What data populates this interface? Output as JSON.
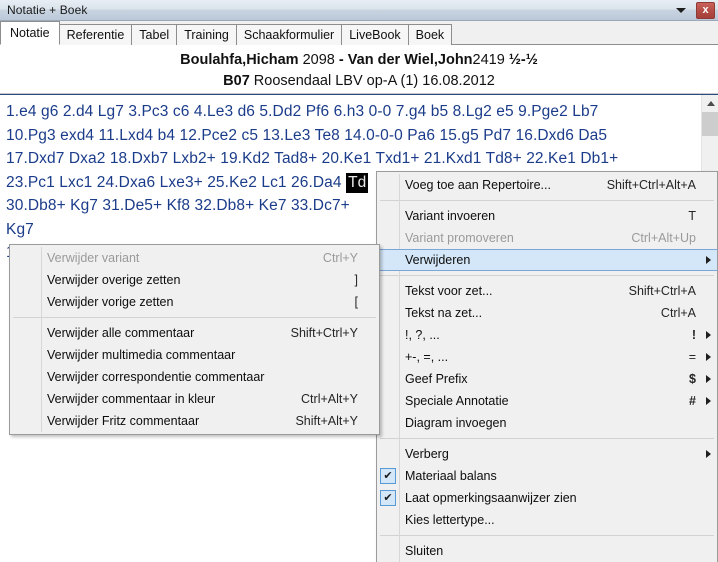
{
  "window": {
    "title": "Notatie + Boek",
    "caret_icon": "chevron-down-icon",
    "close_label": "x"
  },
  "tabs": [
    {
      "label": "Notatie",
      "active": true
    },
    {
      "label": "Referentie",
      "active": false
    },
    {
      "label": "Tabel",
      "active": false
    },
    {
      "label": "Training",
      "active": false
    },
    {
      "label": "Schaakformulier",
      "active": false
    },
    {
      "label": "LiveBook",
      "active": false
    },
    {
      "label": "Boek",
      "active": false
    }
  ],
  "game_header": {
    "white_name": "Boulahfa,Hicham",
    "white_elo": "2098",
    "dash": "-",
    "black_name": "Van der Wiel,John",
    "black_elo": "2419",
    "result": "½-½",
    "eco": "B07",
    "event": "Roosendaal LBV op-A (1) 16.08.2012"
  },
  "notation": {
    "lines": [
      "1.e4 g6 2.d4 Lg7 3.Pc3 c6 4.Le3 d6 5.Dd2 Pf6 6.h3 0-0 7.g4 b5 8.Lg2 e5 9.Pge2 Lb7",
      "10.Pg3 exd4 11.Lxd4 b4 12.Pce2 c5 13.Le3 Te8 14.0-0-0 Pa6 15.g5 Pd7 16.Dxd6 Da5",
      "17.Dxd7 Dxa2 18.Dxb7 Lxb2+ 19.Kd2 Tad8+ 20.Ke1 Txd1+ 21.Kxd1 Td8+ 22.Ke1 Db1+"
    ],
    "line4_pre": "23.Pc1 Lxc1 24.Dxa6 Lxe3+ 25.Ke2 Lc1 26.Da4",
    "selected_move": "Td",
    "line5": "30.Db8+ Kg7 31.De5+ Kf8 32.Db8+ Ke7 33.Dc7+",
    "line6": "Kg7",
    "line7_partial": "1"
  },
  "scrollbar": {
    "up_icon": "chevron-up-icon"
  },
  "main_menu": {
    "items": [
      {
        "label": "Voeg toe aan Repertoire...",
        "accel": "Shift+Ctrl+Alt+A",
        "arrow": false,
        "disabled": false,
        "checked": null,
        "highlighted": false
      },
      {
        "separator": true
      },
      {
        "label": "Variant invoeren",
        "accel": "T",
        "arrow": false,
        "disabled": false,
        "checked": null,
        "highlighted": false
      },
      {
        "label": "Variant promoveren",
        "accel": "Ctrl+Alt+Up",
        "arrow": false,
        "disabled": true,
        "checked": null,
        "highlighted": false
      },
      {
        "label": "Verwijderen",
        "accel": "",
        "arrow": true,
        "disabled": false,
        "checked": null,
        "highlighted": true
      },
      {
        "separator": true
      },
      {
        "label": "Tekst voor zet...",
        "accel": "Shift+Ctrl+A",
        "arrow": false,
        "disabled": false,
        "checked": null,
        "highlighted": false
      },
      {
        "label": "Tekst na zet...",
        "accel": "Ctrl+A",
        "arrow": false,
        "disabled": false,
        "checked": null,
        "highlighted": false
      },
      {
        "label": "!, ?, ...",
        "accel": "!",
        "accel_style": "red",
        "arrow": true,
        "disabled": false,
        "checked": null,
        "highlighted": false
      },
      {
        "label": "+-, =, ...",
        "accel": "=",
        "arrow": true,
        "disabled": false,
        "checked": null,
        "highlighted": false
      },
      {
        "label": "Geef Prefix",
        "accel": "$",
        "accel_style": "dollar",
        "arrow": true,
        "disabled": false,
        "checked": null,
        "highlighted": false
      },
      {
        "label": "Speciale Annotatie",
        "accel": "#",
        "accel_style": "hash",
        "arrow": true,
        "disabled": false,
        "checked": null,
        "highlighted": false
      },
      {
        "label": "Diagram invoegen",
        "accel": "",
        "arrow": false,
        "disabled": false,
        "checked": null,
        "highlighted": false
      },
      {
        "separator": true
      },
      {
        "label": "Verberg",
        "accel": "",
        "arrow": true,
        "disabled": false,
        "checked": null,
        "highlighted": false
      },
      {
        "label": "Materiaal balans",
        "accel": "",
        "arrow": false,
        "disabled": false,
        "checked": true,
        "highlighted": false
      },
      {
        "label": "Laat opmerkingsaanwijzer zien",
        "accel": "",
        "arrow": false,
        "disabled": false,
        "checked": true,
        "highlighted": false
      },
      {
        "label": "Kies lettertype...",
        "accel": "",
        "arrow": false,
        "disabled": false,
        "checked": null,
        "highlighted": false
      },
      {
        "separator": true
      },
      {
        "label": "Sluiten",
        "accel": "",
        "arrow": false,
        "disabled": false,
        "checked": null,
        "highlighted": false
      }
    ]
  },
  "sub_menu": {
    "items": [
      {
        "label": "Verwijder variant",
        "accel": "Ctrl+Y",
        "disabled": true
      },
      {
        "label": "Verwijder overige zetten",
        "accel": "]",
        "disabled": false
      },
      {
        "label": "Verwijder vorige zetten",
        "accel": "[",
        "disabled": false
      },
      {
        "separator": true
      },
      {
        "label": "Verwijder alle commentaar",
        "accel": "Shift+Ctrl+Y",
        "disabled": false
      },
      {
        "label": "Verwijder multimedia commentaar",
        "accel": "",
        "disabled": false
      },
      {
        "label": "Verwijder correspondentie commentaar",
        "accel": "",
        "disabled": false
      },
      {
        "label": "Verwijder commentaar in kleur",
        "accel": "Ctrl+Alt+Y",
        "disabled": false
      },
      {
        "label": "Verwijder Fritz commentaar",
        "accel": "Shift+Alt+Y",
        "disabled": false
      }
    ]
  },
  "colors": {
    "notation_text": "#1b3c8a",
    "highlight_bg": "#d4e7f8",
    "highlight_border": "#7ba7d7",
    "close_button": "#b44b45",
    "selection_bg": "#000000"
  }
}
